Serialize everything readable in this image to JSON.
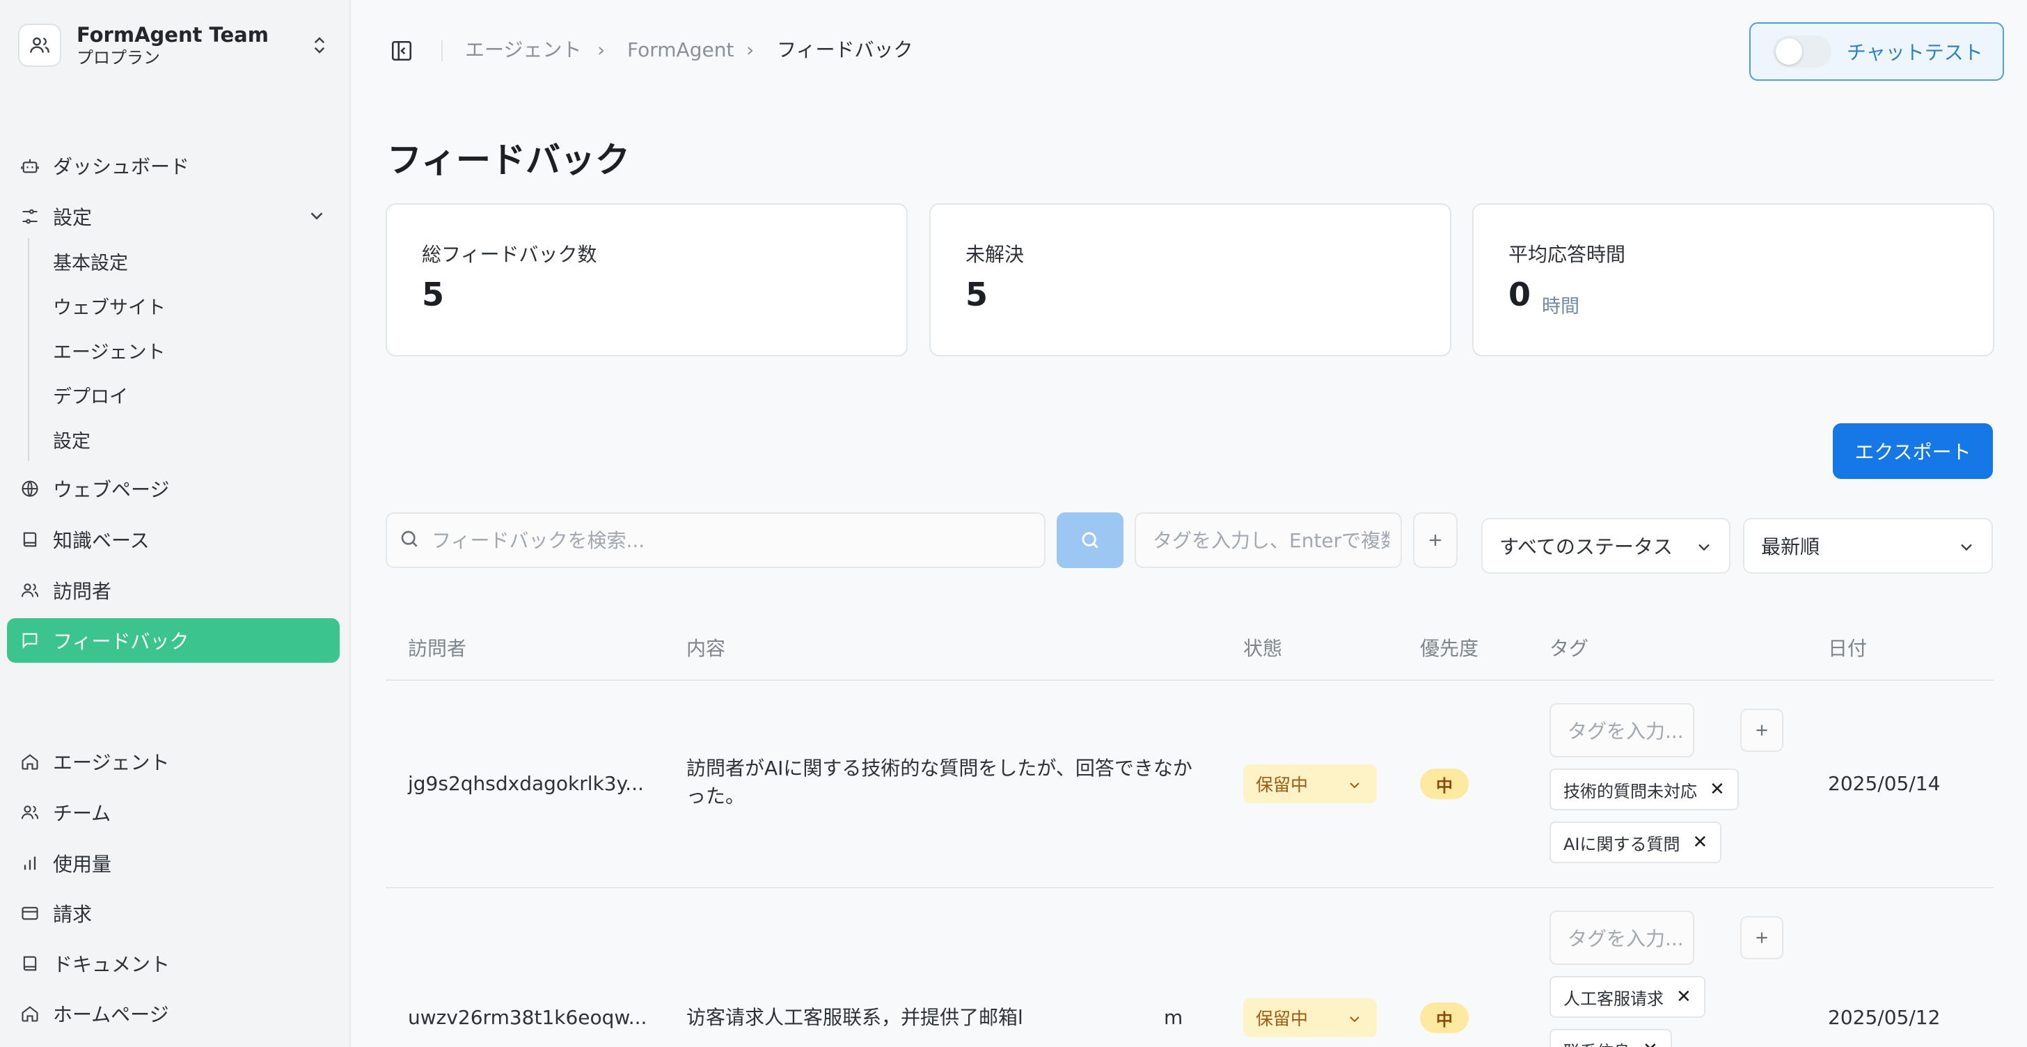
{
  "team": {
    "name": "FormAgent Team",
    "plan": "プロプラン"
  },
  "sidebar": {
    "dashboard": "ダッシュボード",
    "settings": "設定",
    "sub": [
      "基本設定",
      "ウェブサイト",
      "エージェント",
      "デプロイ",
      "設定"
    ],
    "webpages": "ウェブページ",
    "knowledge": "知識ベース",
    "visitors": "訪問者",
    "feedback": "フィードバック",
    "agents": "エージェント",
    "team": "チーム",
    "usage": "使用量",
    "billing": "請求",
    "docs": "ドキュメント",
    "home": "ホームページ"
  },
  "breadcrumb": [
    "エージェント",
    "FormAgent",
    "フィードバック"
  ],
  "chat_test": "チャットテスト",
  "page_title": "フィードバック",
  "stats": {
    "total_label": "総フィードバック数",
    "total_value": "5",
    "open_label": "未解決",
    "open_value": "5",
    "avg_label": "平均応答時間",
    "avg_value": "0",
    "avg_unit": "時間"
  },
  "export_label": "エクスポート",
  "filters": {
    "search_placeholder": "フィードバックを検索...",
    "tag_placeholder": "タグを入力し、Enterで複数",
    "status": "すべてのステータス",
    "sort": "最新順"
  },
  "table": {
    "headers": [
      "訪問者",
      "内容",
      "状態",
      "優先度",
      "タグ",
      "日付"
    ],
    "tag_placeholder": "タグを入力...",
    "rows": [
      {
        "visitor": "jg9s2qhsdxdagokrlk3y...",
        "content_1": "訪問者がAIに関する技術的な質問をしたが、回答できなか",
        "content_2": "った。",
        "status": "保留中",
        "priority": "中",
        "tags": [
          "技術的質問未対応",
          "AIに関する質問"
        ],
        "date": "2025/05/14"
      },
      {
        "visitor": "uwzv26rm38t1k6eoqw...",
        "content_1": "访客请求人工客服联系，并提供了邮箱l",
        "content_2": "m",
        "status": "保留中",
        "priority": "中",
        "tags": [
          "人工客服请求",
          "联系信息"
        ],
        "date": "2025/05/12"
      }
    ]
  },
  "colors": {
    "accent": "#3cc48d",
    "primary": "#1677e6"
  }
}
